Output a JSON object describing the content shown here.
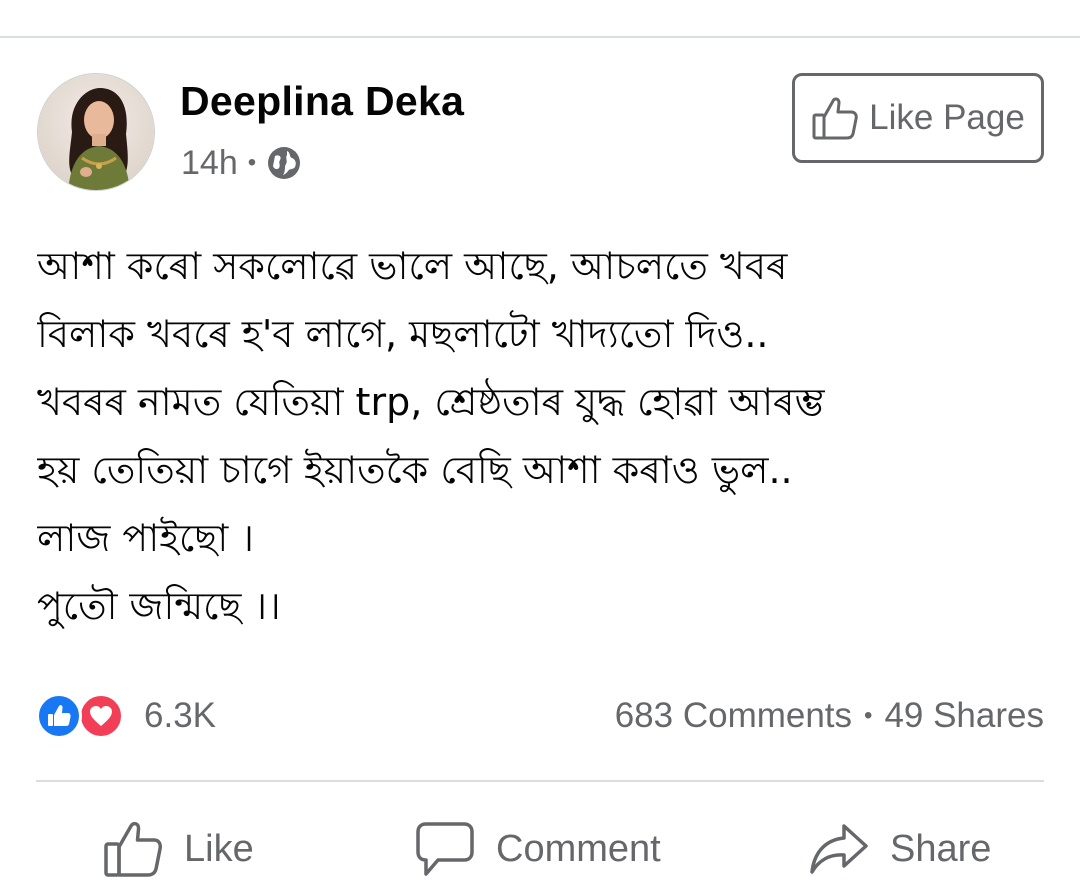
{
  "post": {
    "page_name": "Deeplina Deka",
    "time": "14h",
    "separator": "•",
    "privacy_icon": "globe-icon",
    "like_page_label": "Like Page",
    "body_lines": [
      "আশা কৰো সকলোৱে ভালে আছে, আচলতে খবৰ",
      "বিলাক খবৰে হ'ব লাগে, মছলাটো খাদ্যতো দিও..",
      "খবৰৰ নামত যেতিয়া  trp, শ্ৰেষ্ঠতাৰ যুদ্ধ হোৱা আৰম্ভ",
      "হয় তেতিয়া চাগে ইয়াতকৈ বেছি আশা কৰাও ভুল..",
      "লাজ পাইছো ।",
      "পুতৌ জন্মিছে ।।"
    ]
  },
  "engagement": {
    "reaction_count": "6.3K",
    "reaction_icons": [
      "like-reaction-icon",
      "love-reaction-icon"
    ],
    "comments": "683 Comments",
    "separator": "•",
    "shares": "49 Shares"
  },
  "actions": {
    "like": "Like",
    "comment": "Comment",
    "share": "Share"
  },
  "colors": {
    "secondary_text": "#65676b",
    "primary_text": "#050505",
    "like_blue": "#1877f2",
    "love_red": "#f33e58",
    "divider": "#dadde1"
  }
}
